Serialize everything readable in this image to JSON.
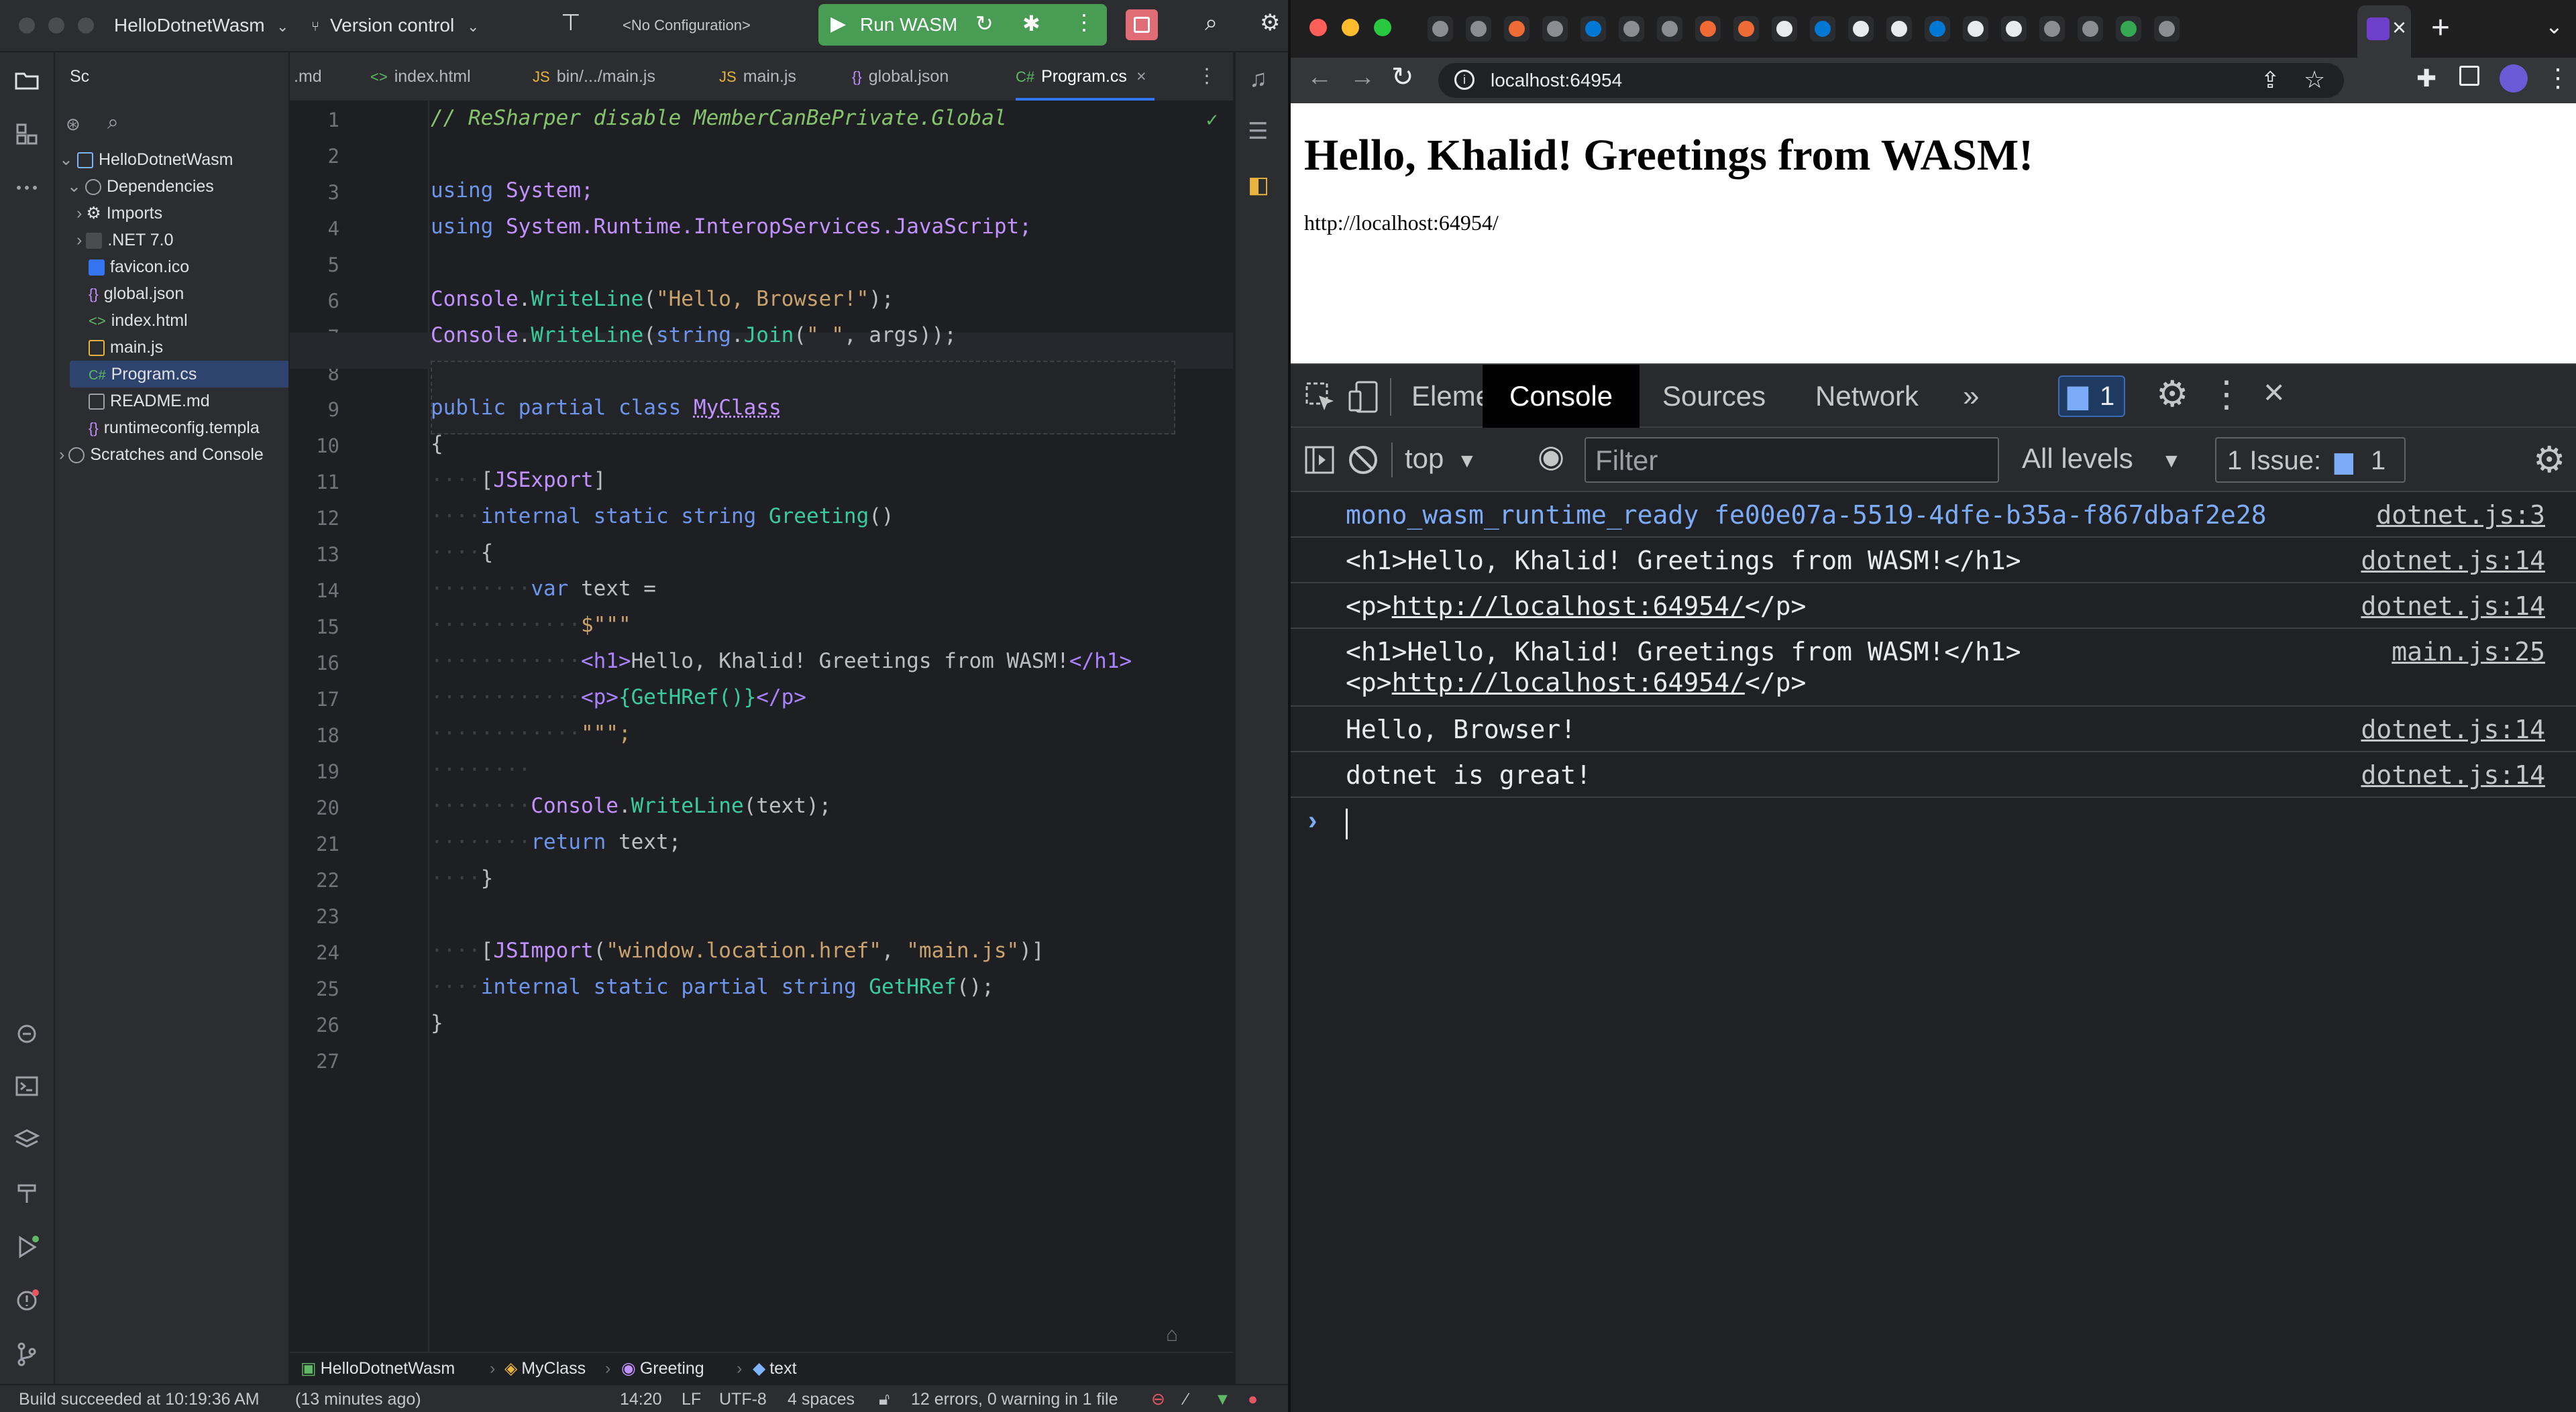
{
  "ide": {
    "project_name": "HelloDotnetWasm",
    "version_control": "Version control",
    "configuration": "<No Configuration>",
    "run_label": "Run WASM",
    "panel_title": "Sc",
    "tree": [
      {
        "label": "HelloDotnetWasm",
        "icon": "project-icon"
      },
      {
        "label": "Dependencies",
        "icon": "dependencies-icon"
      },
      {
        "label": "Imports",
        "icon": "gear-icon"
      },
      {
        "label": ".NET 7.0",
        "icon": "dotnet-icon"
      },
      {
        "label": "favicon.ico",
        "icon": "image-file-icon"
      },
      {
        "label": "global.json",
        "icon": "json-file-icon"
      },
      {
        "label": "index.html",
        "icon": "html-file-icon"
      },
      {
        "label": "main.js",
        "icon": "js-file-icon"
      },
      {
        "label": "Program.cs",
        "icon": "csharp-file-icon"
      },
      {
        "label": "README.md",
        "icon": "markdown-file-icon"
      },
      {
        "label": "runtimeconfig.templa",
        "icon": "json-file-icon"
      },
      {
        "label": "Scratches and Console",
        "icon": "scratches-icon"
      }
    ],
    "tabs": [
      {
        "label": ".md",
        "type": ""
      },
      {
        "label": "index.html",
        "type": "<>"
      },
      {
        "label": "bin/.../main.js",
        "type": "JS"
      },
      {
        "label": "main.js",
        "type": "JS"
      },
      {
        "label": "global.json",
        "type": "{}"
      },
      {
        "label": "Program.cs",
        "type": "C#"
      }
    ],
    "code_lines": [
      "1",
      "2",
      "3",
      "4",
      "5",
      "6",
      "7",
      "8",
      "9",
      "10",
      "11",
      "12",
      "13",
      "14",
      "15",
      "16",
      "17",
      "18",
      "19",
      "20",
      "21",
      "22",
      "23",
      "24",
      "25",
      "26",
      "27"
    ],
    "code": {
      "l1": "// ReSharper disable MemberCanBePrivate.Global",
      "using": "using",
      "system": "System;",
      "interop": "System.Runtime.InteropServices.JavaScript;",
      "console": "Console",
      "writeline": "WriteLine",
      "hello_browser": "\"Hello, Browser!\"",
      "string_kw": "string",
      "join": "Join",
      "space_str": "\" \"",
      "args_tail": ", args));",
      "public": "public",
      "partial": "partial",
      "class": "class",
      "myclass": "MyClass",
      "open_brace": "{",
      "close_brace": "}",
      "jsexport": "JSExport",
      "internal": "internal",
      "static": "static",
      "greeting": "Greeting",
      "var": "var",
      "text_eq": "text =",
      "raw_open": "$\"\"\"",
      "h1_open": "<h1>",
      "h1_text": "Hello, Khalid! Greetings from WASM!",
      "h1_close": "</h1>",
      "p_open": "<p>",
      "p_interp": "{GetHRef()}",
      "p_close": "</p>",
      "raw_close": "\"\"\";",
      "writeline_text": "(text);",
      "return_text": "return",
      "text_semicolon": "text;",
      "jsimport": "JSImport",
      "href_str": "\"window.location.href\"",
      "mainjs_str": "\"main.js\"",
      "gethref": "GetHRef"
    },
    "breadcrumb": [
      "HelloDotnetWasm",
      "MyClass",
      "Greeting",
      "text"
    ],
    "status": {
      "build": "Build succeeded at 10:19:36 AM",
      "ago": "(13 minutes ago)",
      "position": "14:20",
      "line_ending": "LF",
      "encoding": "UTF-8",
      "indent": "4 spaces",
      "errors": "12 errors, 0 warning in 1 file"
    }
  },
  "browser": {
    "url": "localhost:64954",
    "page_heading": "Hello, Khalid! Greetings from WASM!",
    "page_paragraph": "http://localhost:64954/",
    "devtools": {
      "tabs": [
        "Elements",
        "Console",
        "Sources",
        "Network"
      ],
      "issues_count": "1",
      "context": "top",
      "filter_placeholder": "Filter",
      "levels": "All levels",
      "issue_label": "1 Issue:",
      "issue_num": "1",
      "messages": [
        {
          "text": "mono_wasm_runtime_ready fe00e07a-5519-4dfe-b35a-f867dbaf2e28",
          "source": "dotnet.js:3"
        },
        {
          "text": "<h1>Hello, Khalid! Greetings from WASM!</h1>",
          "source": "dotnet.js:14"
        },
        {
          "prefix": "<p>",
          "link": "http://localhost:64954/",
          "suffix": "</p>",
          "source": "dotnet.js:14"
        },
        {
          "text": "<h1>Hello, Khalid! Greetings from WASM!</h1>",
          "prefix": "<p>",
          "link": "http://localhost:64954/",
          "suffix": "</p>",
          "source": "main.js:25"
        },
        {
          "text": "Hello, Browser!",
          "source": "dotnet.js:14"
        },
        {
          "text": "dotnet is great!",
          "source": "dotnet.js:14"
        }
      ]
    }
  },
  "colors": {
    "ide_bg": "#1e1f22",
    "ide_panel": "#2b2d30",
    "run_green": "#499c54",
    "selection": "#2e436e",
    "devtools_bg": "#202124",
    "console_blue": "#7cacf8"
  }
}
